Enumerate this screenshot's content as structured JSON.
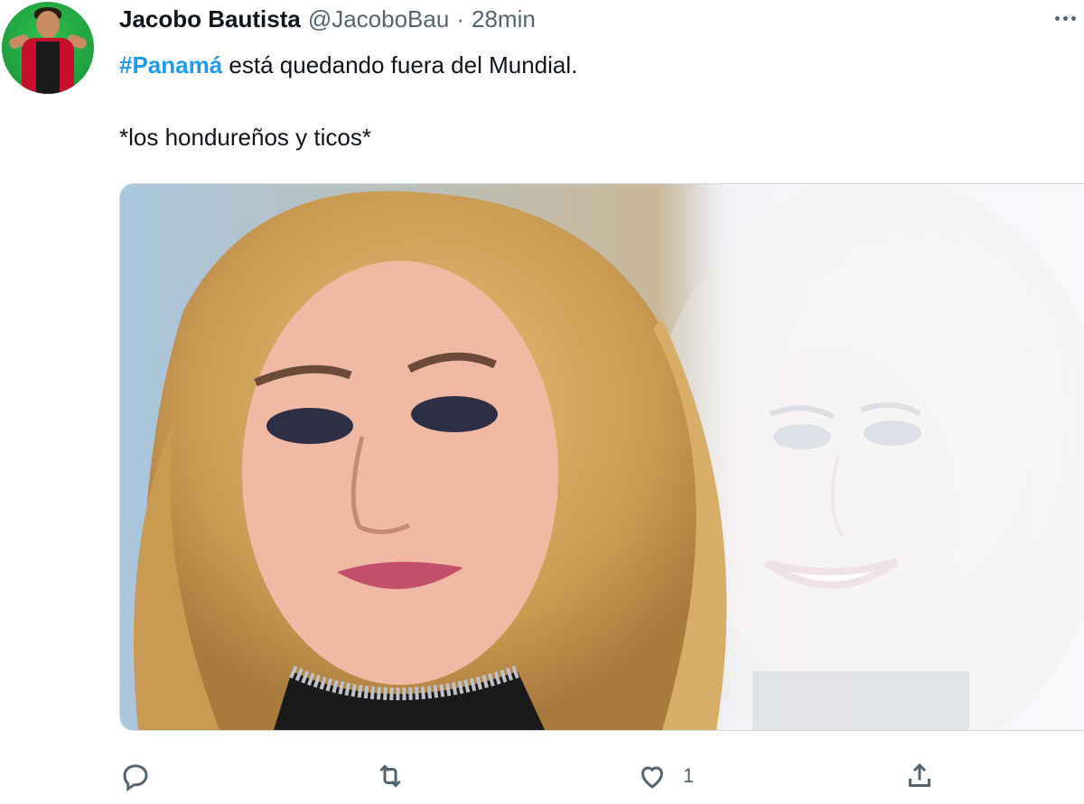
{
  "tweet": {
    "author_name": "Jacobo Bautista",
    "author_handle": "@JacoboBau",
    "separator": "·",
    "timestamp": "28min",
    "hashtag": "#Panamá",
    "text_line1_rest": " está quedando fuera del Mundial.",
    "text_line2": "*los hondureños y ticos*"
  },
  "actions": {
    "reply_count": "",
    "retweet_count": "",
    "like_count": "1",
    "share_count": ""
  },
  "colors": {
    "hashtag": "#1d9bf0",
    "secondary_text": "#536471",
    "primary_text": "#0f1419"
  },
  "icons": {
    "reply": "reply-icon",
    "retweet": "retweet-icon",
    "like": "heart-icon",
    "share": "share-icon",
    "more": "more-icon"
  }
}
